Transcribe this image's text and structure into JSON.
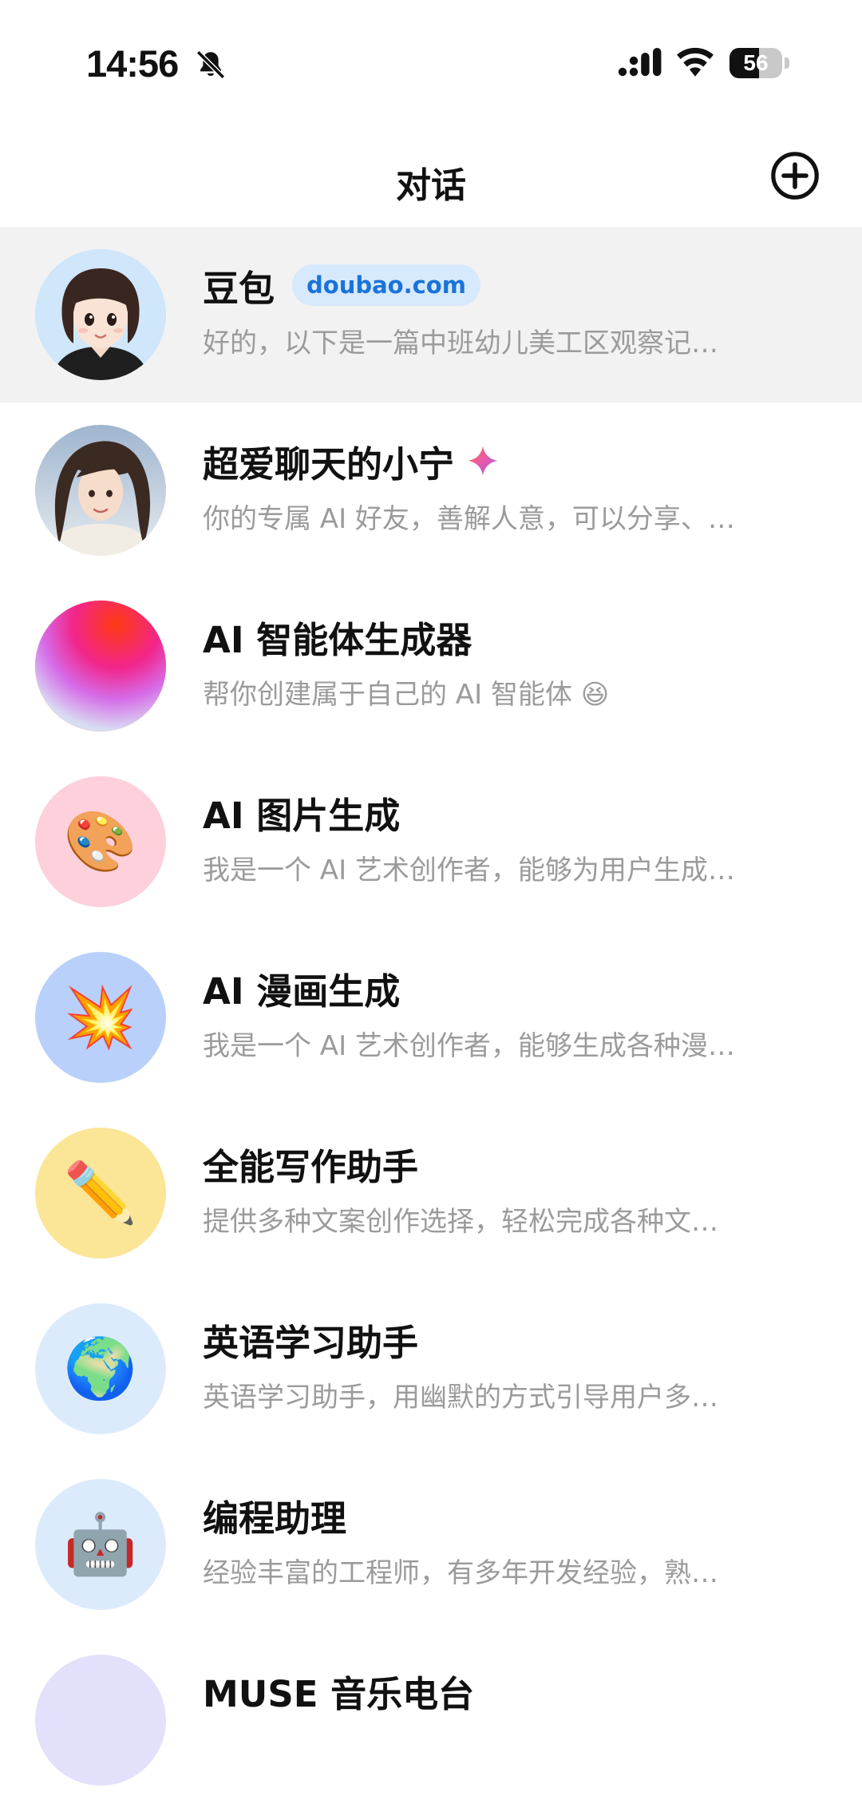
{
  "status_bar": {
    "time": "14:56",
    "battery": "56",
    "battery_level": 0.56,
    "icons": [
      "bell-slash-icon",
      "cellular-signal-icon",
      "wifi-icon",
      "battery-icon"
    ]
  },
  "header": {
    "title": "对话",
    "new_chat_icon": "plus-circle-icon"
  },
  "conversations": [
    {
      "name": "豆包",
      "badge": "doubao.com",
      "preview": "好的，以下是一篇中班幼儿美工区观察记…",
      "avatar": "cartoon-girl",
      "avatar_bg": "#cfe6fb",
      "selected": true
    },
    {
      "name": "超爱聊天的小宁",
      "preview": "你的专属 AI 好友，善解人意，可以分享、…",
      "avatar": "anime-girl-portrait",
      "avatar_bg": "#dfe6ee",
      "sparkle": "#e85aa8"
    },
    {
      "name": "AI 智能体生成器",
      "preview": "帮你创建属于自己的 AI 智能体 😆",
      "avatar": "gradient-orb",
      "avatar_bg": "#ff4a2a"
    },
    {
      "name": "AI 图片生成",
      "preview": "我是一个 AI 艺术创作者，能够为用户生成…",
      "avatar": "🎨",
      "avatar_bg": "#fdd0dc"
    },
    {
      "name": "AI 漫画生成",
      "preview": "我是一个 AI 艺术创作者，能够生成各种漫…",
      "avatar": "💥",
      "avatar_bg": "#b9d0fb"
    },
    {
      "name": "全能写作助手",
      "preview": "提供多种文案创作选择，轻松完成各种文…",
      "avatar": "✏️",
      "avatar_bg": "#fbe597"
    },
    {
      "name": "英语学习助手",
      "preview": "英语学习助手，用幽默的方式引导用户多…",
      "avatar": "🌍",
      "avatar_bg": "#dcebfc"
    },
    {
      "name": "编程助理",
      "preview": "经验丰富的工程师，有多年开发经验，熟…",
      "avatar": "🤖",
      "avatar_bg": "#dcebfc"
    },
    {
      "name": "MUSE 音乐电台",
      "preview": "",
      "avatar": "",
      "avatar_bg": "#e3e0fb"
    }
  ]
}
